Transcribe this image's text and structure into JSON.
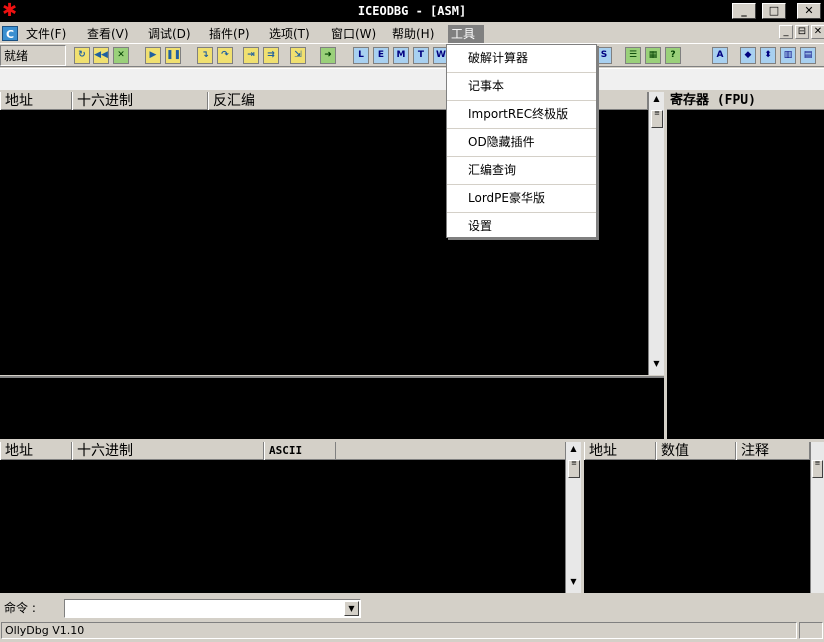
{
  "window": {
    "title": "ICEODBG - [ASM]",
    "controls": [
      "_",
      "□",
      "✕"
    ]
  },
  "menubar": {
    "items": [
      "文件(F)",
      "查看(V)",
      "调试(D)",
      "插件(P)",
      "选项(T)",
      "窗口(W)",
      "帮助(H)",
      "工具"
    ],
    "mdi_controls": [
      "_",
      "⊟",
      "✕"
    ]
  },
  "toolbar": {
    "status": "就绪",
    "letter_buttons": [
      "L",
      "E",
      "M",
      "T",
      "W",
      "S"
    ]
  },
  "tools_menu": {
    "items": [
      "破解计算器",
      "记事本",
      "ImportREC终极版",
      "OD隐藏插件",
      "汇编查询",
      "LordPE豪华版",
      "设置"
    ]
  },
  "cpu_pane": {
    "columns": [
      "地址",
      "十六进制",
      "反汇编"
    ]
  },
  "registers_pane": {
    "title": "寄存器 (FPU)"
  },
  "dump_pane": {
    "columns": [
      "地址",
      "十六进制",
      "ASCII"
    ]
  },
  "stack_pane": {
    "columns": [
      "地址",
      "数值",
      "注释"
    ]
  },
  "command": {
    "label": "命令 :",
    "value": ""
  },
  "statusbar": {
    "text": "OllyDbg V1.10"
  }
}
